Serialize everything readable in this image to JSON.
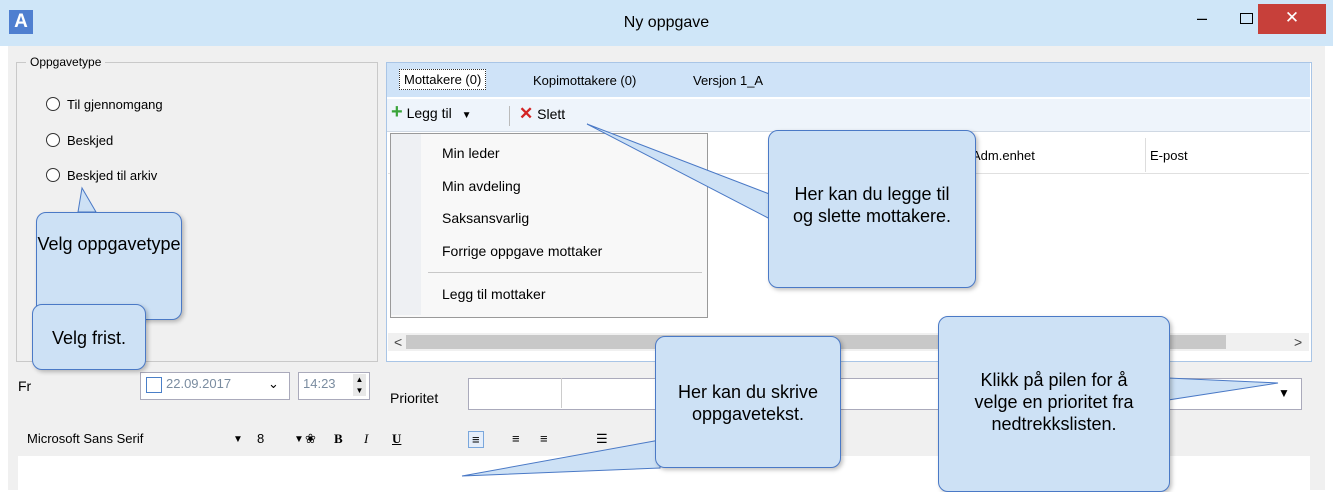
{
  "window": {
    "title": "Ny oppgave",
    "app_icon": "A",
    "min_glyph": "–",
    "close_glyph": "✕"
  },
  "task_type": {
    "legend": "Oppgavetype",
    "options": [
      "Til gjennomgang",
      "Beskjed",
      "Beskjed til arkiv"
    ]
  },
  "tabs": [
    "Mottakere (0)",
    "Kopimottakere (0)",
    "Versjon 1_A"
  ],
  "toolbar": {
    "add_label": "Legg til",
    "delete_label": "Slett"
  },
  "columns": [
    "Adm.enhet",
    "E-post"
  ],
  "add_menu": {
    "items": [
      "Min leder",
      "Min avdeling",
      "Saksansvarlig",
      "Forrige oppgave mottaker"
    ],
    "last_item": "Legg til mottaker"
  },
  "deadline": {
    "label": "Fr",
    "date": "22.09.2017",
    "time": "14:23"
  },
  "priority": {
    "label": "Prioritet"
  },
  "format": {
    "font_name": "Microsoft Sans Serif",
    "font_size": "8"
  },
  "callouts": {
    "velg_type": "Velg oppgavetype",
    "velg_frist": "Velg frist.",
    "mottakere": "Her kan du legge til og slette mottakere.",
    "tekst": "Her kan du skrive oppgavetekst.",
    "prioritet": "Klikk på pilen for å velge en prioritet fra nedtrekkslisten."
  },
  "colors": {
    "titlebar": "#cfe6f8",
    "close": "#c7403a",
    "callout_fill": "#cde1f5",
    "callout_border": "#4a79c6"
  }
}
